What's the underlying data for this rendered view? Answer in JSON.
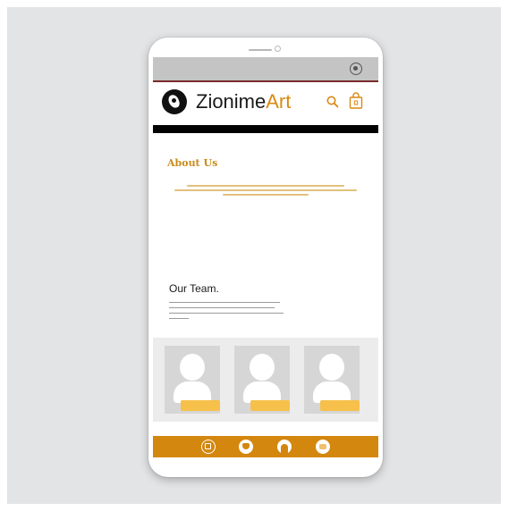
{
  "header": {
    "brand_primary": "Zionime",
    "brand_accent": "Art",
    "icons": [
      "search-icon",
      "shopping-bag-icon"
    ]
  },
  "about": {
    "title": "About Us"
  },
  "team": {
    "title": "Our Team."
  },
  "bottom_nav": {
    "items": [
      "home-icon",
      "shopping-basket-icon",
      "headphones-icon",
      "chat-icon"
    ]
  },
  "colors": {
    "accent": "#d4870e",
    "brand_accent": "#d98a12",
    "about_title": "#c98b1a",
    "status_bar": "#c4c4c4",
    "header_rule": "#7a2a2a",
    "name_tag": "#f6c04a",
    "backdrop": "#e3e4e6"
  }
}
